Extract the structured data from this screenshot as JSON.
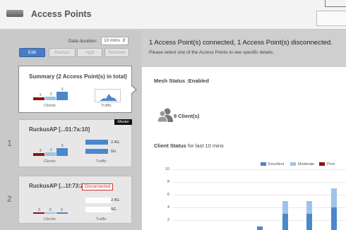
{
  "header": {
    "title": "Access Points"
  },
  "controls": {
    "duration_label": "Data duration:",
    "duration_value": "10 mins",
    "buttons": {
      "edit": "Edit",
      "restart": "Restart",
      "apply": "Appl",
      "remove": "Remove"
    }
  },
  "summary": {
    "title": "Summary (2 Access Point(s) in total)",
    "clients_label": "Clients",
    "traffic_label": "Traffic",
    "counts": [
      "2",
      "2",
      "5"
    ]
  },
  "aps": [
    {
      "index": "1",
      "name": "RuckusAP [...01:7a:10]",
      "tag": "Master",
      "counts": [
        "2",
        "2",
        "5"
      ],
      "bands": [
        "2.4G",
        "5G"
      ],
      "clients_label": "Clients",
      "traffic_label": "Traffic"
    },
    {
      "index": "2",
      "name": "RuckusAP [...1f:73:20]",
      "tag": "Disconnected",
      "counts": [
        "0",
        "0",
        "0"
      ],
      "bands": [
        "2.4G",
        "5G"
      ],
      "clients_label": "Clients",
      "traffic_label": "Traffic"
    }
  ],
  "status": {
    "line": "1 Access Point(s) connected, 1 Access Point(s) disconnected.",
    "hint": "Please select one of the Access Points to see specific details."
  },
  "detail": {
    "mesh": "Mesh Status :Enabled",
    "clients": "9 Client(s)",
    "client_status_bold": "Client Status",
    "client_status_rest": " for last 10 mins"
  },
  "colors": {
    "excellent": "#4b87cc",
    "moderate": "#9fc3e8",
    "poor": "#8b1414"
  },
  "chart_data": {
    "type": "bar",
    "stacked": true,
    "legend": [
      "Excellent",
      "Moderate",
      "Poor"
    ],
    "legend_position": "top-right",
    "yticks": [
      "2",
      "4",
      "6",
      "8",
      "10"
    ],
    "ylim": [
      0,
      10
    ],
    "grid": true,
    "series": [
      {
        "name": "Excellent",
        "values": [
          1,
          3,
          3,
          4,
          4
        ]
      },
      {
        "name": "Moderate",
        "values": [
          0,
          2,
          2,
          3,
          2
        ]
      },
      {
        "name": "Poor",
        "values": [
          0,
          0,
          0,
          0,
          0
        ]
      }
    ]
  }
}
